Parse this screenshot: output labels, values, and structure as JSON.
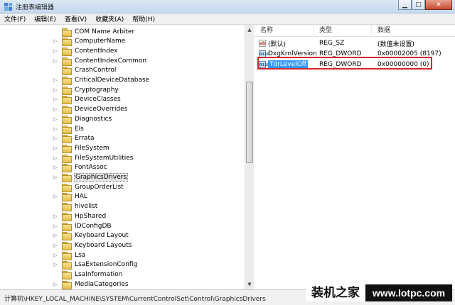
{
  "window": {
    "title": "注册表编辑器"
  },
  "menu": [
    "文件(F)",
    "编辑(E)",
    "查看(V)",
    "收藏夹(A)",
    "帮助(H)"
  ],
  "tree": {
    "items": [
      {
        "label": "COM Name Arbiter",
        "expandable": false
      },
      {
        "label": "ComputerName",
        "expandable": true
      },
      {
        "label": "ContentIndex",
        "expandable": true
      },
      {
        "label": "ContentIndexCommon",
        "expandable": true
      },
      {
        "label": "CrashControl",
        "expandable": false
      },
      {
        "label": "CriticalDeviceDatabase",
        "expandable": true
      },
      {
        "label": "Cryptography",
        "expandable": true
      },
      {
        "label": "DeviceClasses",
        "expandable": true
      },
      {
        "label": "DeviceOverrides",
        "expandable": true
      },
      {
        "label": "Diagnostics",
        "expandable": true
      },
      {
        "label": "Els",
        "expandable": true
      },
      {
        "label": "Errata",
        "expandable": true
      },
      {
        "label": "FileSystem",
        "expandable": true
      },
      {
        "label": "FileSystemUtilities",
        "expandable": true
      },
      {
        "label": "FontAssoc",
        "expandable": true
      },
      {
        "label": "GraphicsDrivers",
        "expandable": true,
        "selected": true
      },
      {
        "label": "GroupOrderList",
        "expandable": false
      },
      {
        "label": "HAL",
        "expandable": true
      },
      {
        "label": "hivelist",
        "expandable": false
      },
      {
        "label": "HpShared",
        "expandable": true
      },
      {
        "label": "IDConfigDB",
        "expandable": true
      },
      {
        "label": "Keyboard Layout",
        "expandable": true
      },
      {
        "label": "Keyboard Layouts",
        "expandable": true
      },
      {
        "label": "Lsa",
        "expandable": true
      },
      {
        "label": "LsaExtensionConfig",
        "expandable": true
      },
      {
        "label": "LsaInformation",
        "expandable": false
      },
      {
        "label": "MediaCategories",
        "expandable": true
      }
    ]
  },
  "list": {
    "headers": {
      "name": "名称",
      "type": "类型",
      "data": "数据"
    },
    "rows": [
      {
        "icon": "string-value-icon",
        "name": "(默认)",
        "type": "REG_SZ",
        "data": "(数值未设置)"
      },
      {
        "icon": "binary-value-icon",
        "name": "DxgKrnlVersion",
        "type": "REG_DWORD",
        "data": "0x00002005 (8197)"
      },
      {
        "icon": "binary-value-icon",
        "name": "TdrLevelOff",
        "type": "REG_DWORD",
        "data": "0x00000000 (0)",
        "selected": true
      }
    ]
  },
  "status": {
    "path": "计算机\\HKEY_LOCAL_MACHINE\\SYSTEM\\CurrentControlSet\\Control\\GraphicsDrivers"
  },
  "watermark": {
    "brand": "装机之家",
    "url": "www.lotpc.com"
  },
  "colors": {
    "selection": "#3399ff",
    "highlight_border": "#d9232c"
  }
}
